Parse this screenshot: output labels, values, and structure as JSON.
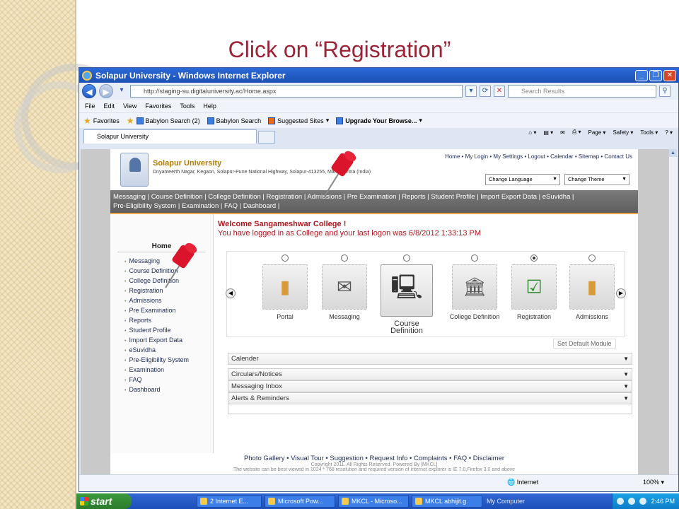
{
  "slide": {
    "title": "Click on “Registration”"
  },
  "window": {
    "title": "Solapur University - Windows Internet Explorer",
    "controls": {
      "minimize": "_",
      "maximize": "❐",
      "close": "✕"
    }
  },
  "address": {
    "url": "http://staging-su.digitaluniversity.ac/Home.aspx",
    "search_placeholder": "Search Results"
  },
  "menu": [
    "File",
    "Edit",
    "View",
    "Favorites",
    "Tools",
    "Help"
  ],
  "favorites": {
    "label": "Favorites",
    "items": [
      "Babylon Search (2)",
      "Babylon Search",
      "Suggested Sites",
      "Upgrade Your Browse..."
    ]
  },
  "tab": {
    "label": "Solapur University"
  },
  "commandbar": [
    "Page",
    "Safety",
    "Tools"
  ],
  "site": {
    "name": "Solapur University",
    "address": "Dnyanteerth Nagar, Kegaon, Solapur-Pune National Highway, Solapur-413255, Maharashtra (India)",
    "top_links": "Home  •  My Login  •  My Settings  •  Logout  •  Calendar  •  Sitemap  •  Contact Us",
    "change_language": "Change Language",
    "change_theme": "Change Theme",
    "nav_line1": "Messaging | Course Definition | College Definition | Registration | Admissions | Pre Examination | Reports | Student Profile | Import Export Data | eSuvidha |",
    "nav_line2": "Pre-Eligibility System | Examination | FAQ | Dashboard |"
  },
  "sidebar": {
    "title": "Home",
    "items": [
      "Messaging",
      "Course Definition",
      "College Definition",
      "Registration",
      "Admissions",
      "Pre Examination",
      "Reports",
      "Student Profile",
      "Import Export Data",
      "eSuvidha",
      "Pre-Eligibility System",
      "Examination",
      "FAQ",
      "Dashboard"
    ]
  },
  "welcome": {
    "line1": "Welcome Sangameshwar College !",
    "line2": "You have logged in as College and your last logon was 6/8/2012 1:33:13 PM"
  },
  "modules": {
    "items": [
      {
        "label": "Portal",
        "icon": "folder-icon"
      },
      {
        "label": "Messaging",
        "icon": "mail-icon"
      },
      {
        "label": "Course Definition",
        "icon": "computer-icon"
      },
      {
        "label": "College Definition",
        "icon": "building-icon"
      },
      {
        "label": "Registration",
        "icon": "checklist-icon",
        "selected": true
      },
      {
        "label": "Admissions",
        "icon": "folder-icon"
      }
    ],
    "set_default": "Set Default Module"
  },
  "panels": [
    "Calender",
    "Circulars/Notices",
    "Messaging Inbox",
    "Alerts & Reminders"
  ],
  "footer": {
    "links": "Photo Gallery  •  Visual Tour  •  Suggestion  •  Request Info  •  Complaints  •  FAQ  •  Disclaimer",
    "copyright": "Copyright 2011. All Rights Reserved. Powered By [MKCL]",
    "note": "The website can be best viewed in 1024 * 768 resolution and required version of internet explorer is IE 7.0,Firefox 3.0 and above"
  },
  "status": {
    "zone": "Internet",
    "zoom": "100%"
  },
  "taskbar": {
    "start": "start",
    "tasks": [
      "2 Internet E...",
      "Microsoft Pow...",
      "MKCL - Microso...",
      "MKCL abhijit.g"
    ],
    "my_computer": "My Computer",
    "time": "2:46 PM"
  }
}
